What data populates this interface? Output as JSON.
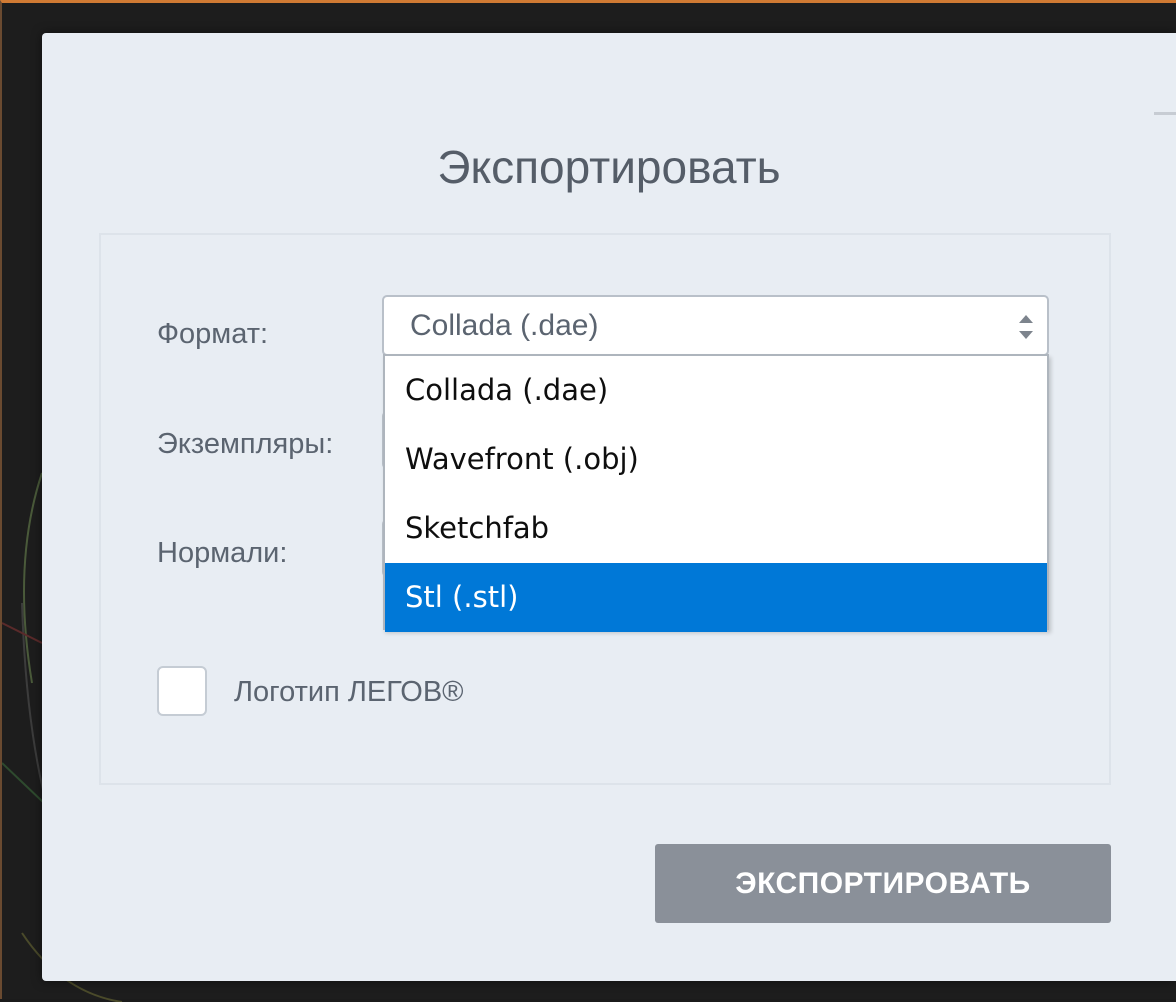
{
  "dialog": {
    "title": "Экспортировать",
    "minimize_icon": "minimize-icon"
  },
  "form": {
    "format_label": "Формат:",
    "instances_label": "Экземпляры:",
    "normals_label": "Нормали:",
    "format_select": {
      "value": "Collada (.dae)",
      "arrows_icon": "updown-arrows-icon",
      "options": [
        {
          "label": "Collada (.dae)",
          "selected": false
        },
        {
          "label": "Wavefront (.obj)",
          "selected": false
        },
        {
          "label": "Sketchfab",
          "selected": false
        },
        {
          "label": "Stl (.stl)",
          "selected": true
        }
      ]
    },
    "logo_checkbox": {
      "label": "Логотип ЛЕГОВ®",
      "checked": false
    }
  },
  "actions": {
    "export_label": "ЭКСПОРТИРОВАТЬ"
  },
  "colors": {
    "highlight": "#0078d7",
    "button": "#8a9099",
    "dialog_bg": "#e8edf3",
    "text": "#5b6470"
  }
}
